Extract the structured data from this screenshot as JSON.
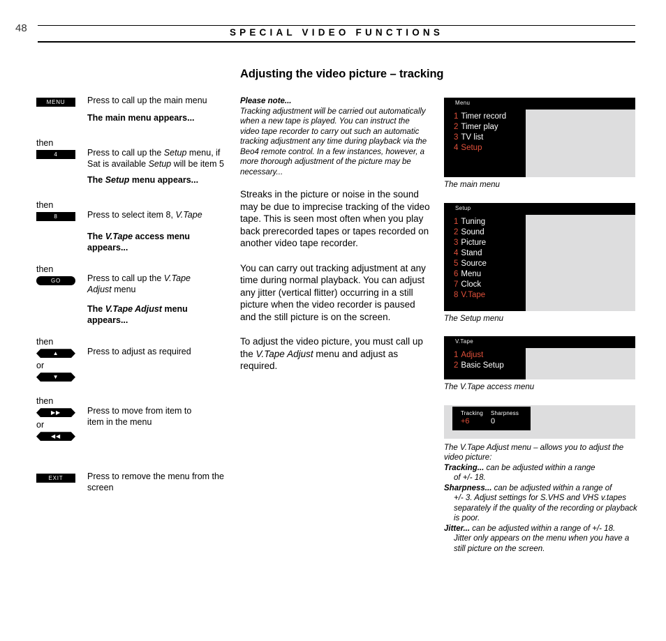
{
  "header": {
    "page_number": "48",
    "running_head": "SPECIAL VIDEO FUNCTIONS"
  },
  "main": {
    "title": "Adjusting the video picture – tracking",
    "please_note_heading": "Please note...",
    "please_note_body": "Tracking adjustment will be carried out automatically when a new tape is played. You can instruct the video tape recorder to carry out such an automatic tracking adjustment any time during playback via the Beo4 remote control. In a few instances, however, a more thorough adjustment of the picture may be necessary...",
    "paragraph_1": "Streaks in the picture or noise in the sound may be due to imprecise tracking of the video tape. This is seen most often when you play back prerecorded tapes or tapes recorded on another video tape recorder.",
    "paragraph_2": "You can carry out tracking adjustment at any time during normal playback. You can adjust any jitter (vertical flitter) occurring in a still picture when the video recorder is paused and the still picture is on the screen.",
    "paragraph_3_a": "To adjust the video picture, you must call up the ",
    "paragraph_3_em": "V.Tape Adjust",
    "paragraph_3_b": " menu and adjust as required."
  },
  "instructions": {
    "then_label": "then",
    "or_label": "or",
    "steps": [
      {
        "button": "MENU",
        "button_shape": "rect",
        "text": "Press to call up the main menu"
      },
      {
        "note": "The main menu appears..."
      },
      {
        "button": "4",
        "button_shape": "rect",
        "text_a": "Press to call up the ",
        "text_em": "Setup",
        "text_b": " menu, if Sat is available ",
        "text_em2": "Setup",
        "text_c": " will be item 5"
      },
      {
        "note_a": "The ",
        "note_em": "Setup",
        "note_b": " menu appears..."
      },
      {
        "button": "8",
        "button_shape": "rect",
        "text_a": "Press to select item 8, ",
        "text_em": "V.Tape"
      },
      {
        "note_a": "The ",
        "note_em": "V.Tape",
        "note_b": " access menu appears..."
      },
      {
        "button": "GO",
        "button_shape": "pill",
        "text_a": "Press to call up the ",
        "text_em": "V.Tape Adjust",
        "text_b": " menu"
      },
      {
        "note_a": "The ",
        "note_em": "V.Tape Adjust",
        "note_b": " menu appears..."
      },
      {
        "button": "▲",
        "button_alt": "▼",
        "button_shape": "hex",
        "text": "Press to adjust as required",
        "icon_up": "arrow-up-icon",
        "icon_down": "arrow-down-icon"
      },
      {
        "button": "▶▶",
        "button_alt": "◀◀",
        "button_shape": "hex",
        "text": "Press to move from item to item in the menu",
        "icon_forward": "fast-forward-icon",
        "icon_back": "rewind-icon"
      },
      {
        "button": "EXIT",
        "button_shape": "rect",
        "text": "Press to remove the menu from the screen"
      }
    ]
  },
  "screens": [
    {
      "id": "main-menu",
      "title": "Menu",
      "items": [
        {
          "num": "1",
          "label": "Timer record",
          "selected": false
        },
        {
          "num": "2",
          "label": "Timer play",
          "selected": false
        },
        {
          "num": "3",
          "label": "TV list",
          "selected": false
        },
        {
          "num": "4",
          "label": "Setup",
          "selected": true
        }
      ],
      "caption": "The main menu"
    },
    {
      "id": "setup-menu",
      "title": "Setup",
      "items": [
        {
          "num": "1",
          "label": "Tuning",
          "selected": false
        },
        {
          "num": "2",
          "label": "Sound",
          "selected": false
        },
        {
          "num": "3",
          "label": "Picture",
          "selected": false
        },
        {
          "num": "4",
          "label": "Stand",
          "selected": false
        },
        {
          "num": "5",
          "label": "Source",
          "selected": false
        },
        {
          "num": "6",
          "label": "Menu",
          "selected": false
        },
        {
          "num": "7",
          "label": "Clock",
          "selected": false
        },
        {
          "num": "8",
          "label": "V.Tape",
          "selected": true
        }
      ],
      "caption": "The Setup menu"
    },
    {
      "id": "vtape-access-menu",
      "title": "V.Tape",
      "items": [
        {
          "num": "1",
          "label": "Adjust",
          "selected": true
        },
        {
          "num": "2",
          "label": "Basic Setup",
          "selected": false
        }
      ],
      "caption": "The V.Tape access menu"
    }
  ],
  "adjust_screen": {
    "fields": [
      {
        "name": "Tracking",
        "value": "+6",
        "highlighted": true
      },
      {
        "name": "Sharpness",
        "value": "0",
        "highlighted": false
      }
    ],
    "caption_intro": "The V.Tape Adjust menu – allows you to adjust the video picture:",
    "entries": [
      {
        "term": "Tracking...",
        "desc": " can be adjusted within a range",
        "cont": "of +/- 18."
      },
      {
        "term": "Sharpness...",
        "desc": " can be adjusted within a range  of",
        "cont": "+/- 3. Adjust settings for S.VHS and VHS v.tapes separately if the quality of the recording or playback is poor."
      },
      {
        "term": "Jitter...",
        "desc": " can be adjusted within a range  of +/- 18.",
        "cont": "Jitter only appears on the menu when you have a still picture on the screen."
      }
    ]
  },
  "colors": {
    "accent_red": "#e0503a",
    "screen_black": "#000000",
    "screen_grey": "#ddddde"
  }
}
